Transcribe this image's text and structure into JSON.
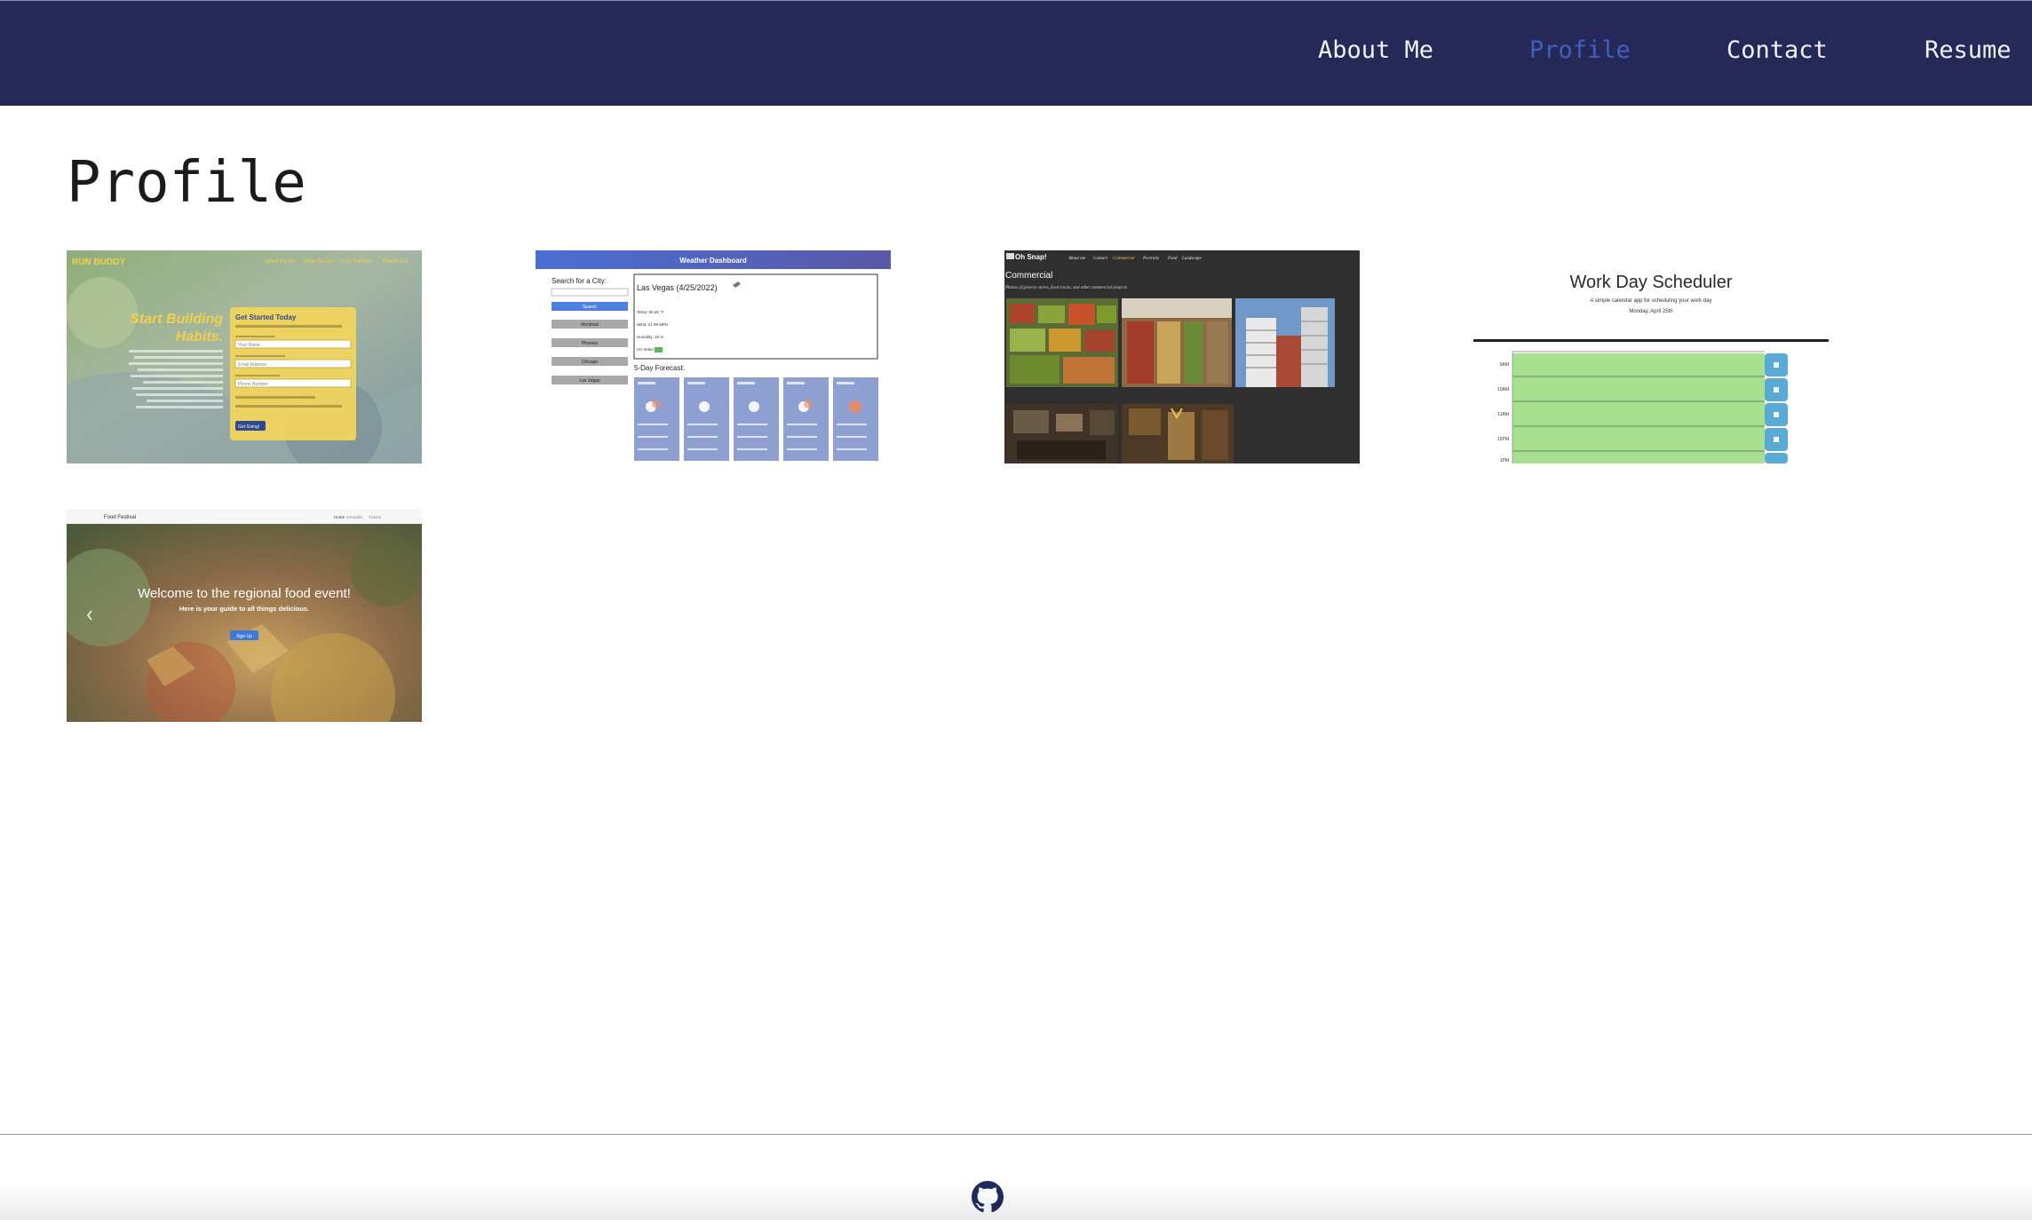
{
  "nav": {
    "links": [
      {
        "label": "About Me"
      },
      {
        "label": "Profile",
        "active": true
      },
      {
        "label": "Contact"
      },
      {
        "label": "Resume"
      }
    ]
  },
  "page": {
    "title": "Profile"
  },
  "projects": [
    {
      "brand": "RUN BUDDY",
      "nav_items": [
        "What We Do",
        "What You Do",
        "Your Trainers",
        "Reach Out"
      ],
      "headline_1": "Start Building",
      "headline_2": "Habits.",
      "form_title": "Get Started Today",
      "fields": [
        "Your Name",
        "Email Address",
        "Phone Number"
      ],
      "button": "Get Going!"
    },
    {
      "header": "Weather Dashboard",
      "search_label": "Search for a City:",
      "search_button": "Search",
      "history": [
        "Montreal",
        "Phoenix",
        "Chicago",
        "Las Vegas"
      ],
      "current_city": "Las Vegas (4/25/2022)",
      "stats": [
        "Temp: 80.26 °F",
        "Wind: 21.99 MPH",
        "Humidity: 15 %",
        "UV Index: 1.52"
      ],
      "forecast_title": "5-Day Forecast:"
    },
    {
      "brand": "Oh Snap!",
      "nav_items": [
        "About me",
        "Contact",
        "Commercial",
        "Portraits",
        "Food",
        "Landscape"
      ],
      "section": "Commercial",
      "caption": "Photos of grocery stores, food trucks, and other commercial projects"
    },
    {
      "title": "Work Day Scheduler",
      "subtitle": "A simple calendar app for scheduling your work day",
      "date": "Monday, April 25th",
      "hours": [
        "9AM",
        "10AM",
        "11AM",
        "12PM",
        "1PM"
      ]
    },
    {
      "brand": "Food Festival",
      "nav_items": [
        "Home",
        "Schedule",
        "Tickets"
      ],
      "headline": "Welcome to the regional food event!",
      "subheadline": "Here is your guide to all things delicious.",
      "button": "Sign Up"
    }
  ],
  "footer": {
    "icon": "github-icon"
  },
  "colors": {
    "navbar_bg": "#262858",
    "nav_text": "#f1f1f6",
    "nav_active": "#3f60c0",
    "title_text": "#1b1b1b"
  }
}
